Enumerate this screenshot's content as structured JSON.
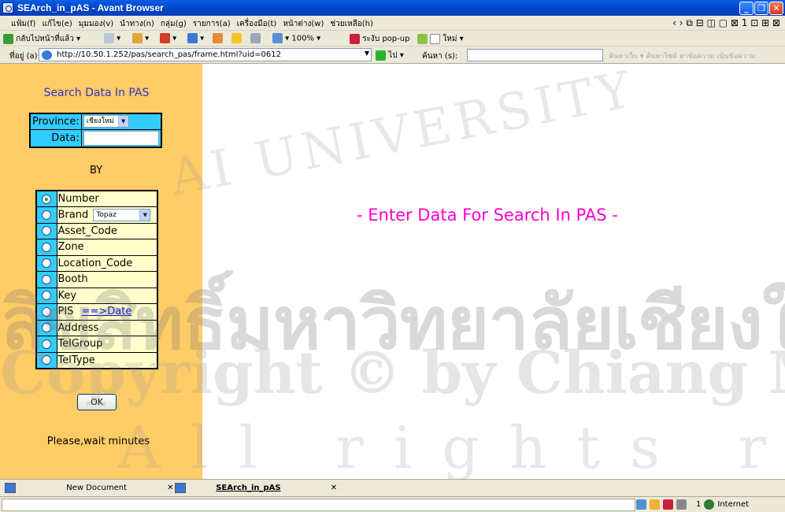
{
  "window": {
    "title": "SEArch_in_pAS - Avant Browser",
    "buttons": [
      "_",
      "❐",
      "✕"
    ]
  },
  "menubar": {
    "items": [
      "แฟ้ม(f)",
      "แก้ไข(e)",
      "มุมมอง(v)",
      "นำทาง(n)",
      "กลุ่ม(g)",
      "รายการ(a)",
      "เครื่องมือ(t)",
      "หน้าต่าง(w)",
      "ช่วยเหลือ(h)"
    ],
    "nav_glyphs": "‹ › ⧉ ⊟ ◫ ▢ ⊠ 1 ⊡ ⊞ ⊠"
  },
  "toolbar": {
    "back_label": "กลับไปหน้าที่แล้ว",
    "zoom": "100%",
    "popup_label": "ระงับ pop-up",
    "new_label": "ใหม่"
  },
  "addressbar": {
    "label": "ที่อยู่ (a):",
    "url": "http://10.50.1.252/pas/search_pas/frame.html?uid=0612",
    "go_label": "ไป",
    "search_label": "ค้นหา (s):",
    "search_value": "",
    "ghost_text": "ค้นหาเว็บ ▾  ค้นหาไซต์   หาข้อความ   เน้นข้อความ"
  },
  "left_panel": {
    "title": "Search Data In PAS",
    "province_label": "Province:",
    "province_value": "เชียงใหม่",
    "data_label": "Data:",
    "data_value": "",
    "by_label": "BY",
    "options": [
      {
        "label": "Number",
        "selected": true
      },
      {
        "label": "Brand",
        "select": "Topaz"
      },
      {
        "label": "Asset_Code"
      },
      {
        "label": "Zone"
      },
      {
        "label": "Location_Code"
      },
      {
        "label": "Booth"
      },
      {
        "label": "Key"
      },
      {
        "label": "PIS",
        "link": "==>Date"
      },
      {
        "label": "Address"
      },
      {
        "label": "TelGroup"
      },
      {
        "label": "TelType"
      }
    ],
    "ok_label": "OK",
    "wait_text": "Please,wait minutes"
  },
  "right_panel": {
    "message": "- Enter Data For Search In PAS -"
  },
  "watermark": {
    "line1": "AI UNIVERSITY",
    "line2": "ลิขสิทธิ์มหาวิทยาลัยเชียงใหม่",
    "line3": "Copyright © by Chiang Mai University",
    "line4": "All rights reserved"
  },
  "tabs": [
    {
      "label": "New Document"
    },
    {
      "label": "SEArch_in_pAS",
      "active": true
    }
  ],
  "statusbar": {
    "count": "1",
    "zone": "Internet"
  },
  "colors": {
    "left_bg": "#FFCC66",
    "cell_blue": "#33CCFF",
    "cell_yellow": "#FFFFCC",
    "title_blue": "#3333CC",
    "message_magenta": "#FF00CC"
  }
}
